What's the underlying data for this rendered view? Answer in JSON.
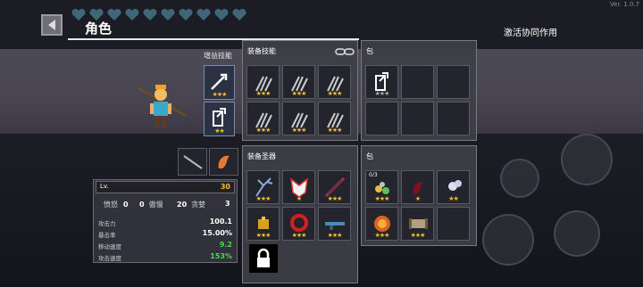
{
  "version": "Ver. 1.0.7",
  "header": {
    "title": "角色",
    "synergy_button": "激活协同作用"
  },
  "player": {
    "hearts": 10
  },
  "skills": {
    "label": "增益技能"
  },
  "stats": {
    "level_label": "Lv.",
    "level_value": "30",
    "traits": [
      {
        "value": "0",
        "label": "愤怒"
      },
      {
        "value": "0",
        "label": "傲慢"
      },
      {
        "value": "20",
        "label": "贪婪"
      },
      {
        "value": "3",
        "label": ""
      }
    ],
    "lines": [
      {
        "label": "攻击力",
        "value": "100.1",
        "color": "#ffffff"
      },
      {
        "label": "暴击率",
        "value": "15.00%",
        "color": "#ffffff"
      },
      {
        "label": "移动速度",
        "value": "9.2",
        "color": "#4ad84a"
      },
      {
        "label": "攻击速度",
        "value": "153%",
        "color": "#4ad84a"
      }
    ]
  },
  "panels": {
    "equip_skills": "装备技能",
    "bag_top": "包",
    "equip_relics": "装备圣器",
    "bag_bottom": "包"
  },
  "relic_bag_counts": [
    "0/3"
  ],
  "stars": {
    "one": "★",
    "two": "★★",
    "three": "★★★"
  }
}
